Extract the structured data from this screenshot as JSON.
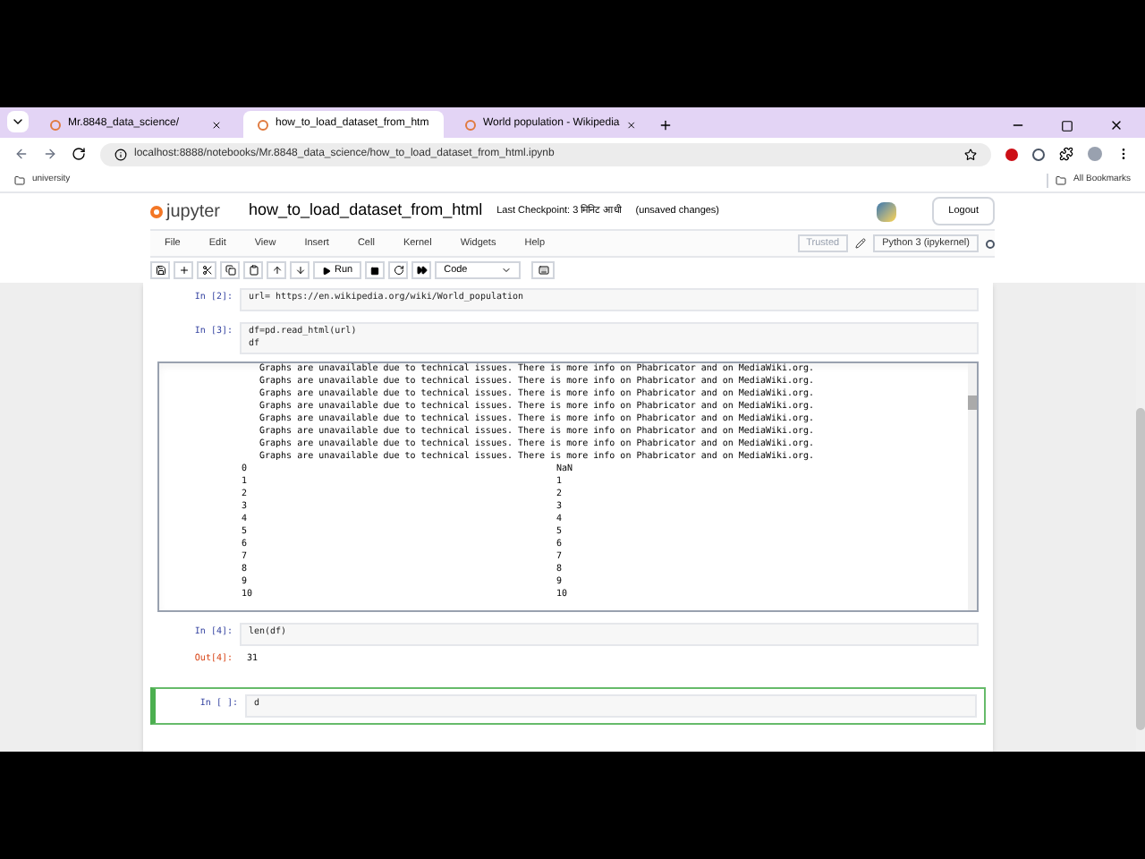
{
  "browser": {
    "tabs": [
      {
        "title": "Mr.8848_data_science/",
        "selected": false
      },
      {
        "title": "how_to_load_dataset_from_htm",
        "selected": true
      },
      {
        "title": "World population - Wikipedia",
        "selected": false
      }
    ],
    "url": "localhost:8888/notebooks/Mr.8848_data_science/how_to_load_dataset_from_html.ipynb",
    "bookmarks": [
      {
        "label": "university"
      }
    ],
    "all_bookmarks": "All Bookmarks"
  },
  "jupyter": {
    "logo_text": "jupyter",
    "notebook": "how_to_load_dataset_from_html",
    "checkpoint": "Last Checkpoint: 3 मिनिट आधी",
    "unsaved": "(unsaved changes)",
    "logout": "Logout",
    "menu": [
      "File",
      "Edit",
      "View",
      "Insert",
      "Cell",
      "Kernel",
      "Widgets",
      "Help"
    ],
    "trusted": "Trusted",
    "kernel": "Python 3 (ipykernel)",
    "run_label": "Run",
    "cell_type": "Code"
  },
  "cells": [
    {
      "prompt": "In [2]:",
      "code": [
        "url= https://en.wikipedia.org/wiki/World_population"
      ],
      "active": false
    },
    {
      "prompt": "In [3]:",
      "code": [
        "df=pd.read_html(url)",
        "df"
      ],
      "active": false,
      "output": {
        "text_lines": [
          "Graphs are unavailable due to technical issues. There is more info on Phabricator and on MediaWiki.org.",
          "Graphs are unavailable due to technical issues. There is more info on Phabricator and on MediaWiki.org.",
          "Graphs are unavailable due to technical issues. There is more info on Phabricator and on MediaWiki.org.",
          "Graphs are unavailable due to technical issues. There is more info on Phabricator and on MediaWiki.org.",
          "Graphs are unavailable due to technical issues. There is more info on Phabricator and on MediaWiki.org.",
          "Graphs are unavailable due to technical issues. There is more info on Phabricator and on MediaWiki.org.",
          "Graphs are unavailable due to technical issues. There is more info on Phabricator and on MediaWiki.org.",
          "Graphs are unavailable due to technical issues. There is more info on Phabricator and on MediaWiki.org."
        ],
        "rows": [
          [
            "0",
            "NaN"
          ],
          [
            "1",
            "1"
          ],
          [
            "2",
            "2"
          ],
          [
            "3",
            "3"
          ],
          [
            "4",
            "4"
          ],
          [
            "5",
            "5"
          ],
          [
            "6",
            "6"
          ],
          [
            "7",
            "7"
          ],
          [
            "8",
            "8"
          ],
          [
            "9",
            "9"
          ],
          [
            "10",
            "10"
          ]
        ]
      }
    },
    {
      "prompt": "In [4]:",
      "code": [
        "len(df)"
      ],
      "active": false,
      "out_prompt": "Out[4]:",
      "result": "31"
    },
    {
      "prompt": "In [ ]:",
      "code": [
        "d"
      ],
      "active": true
    }
  ]
}
